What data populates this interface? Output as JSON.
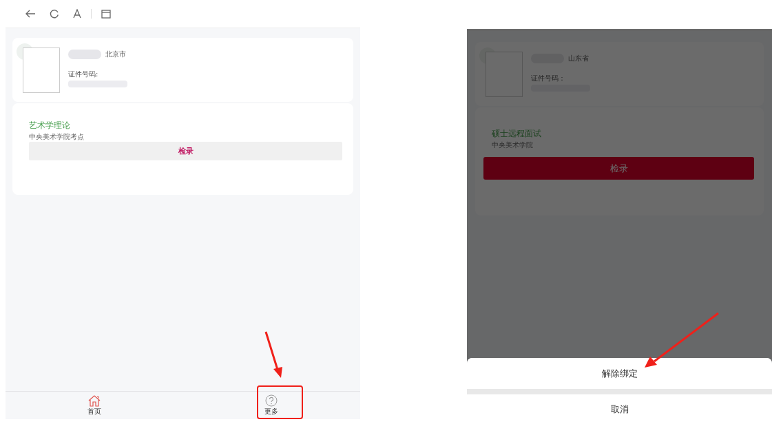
{
  "left_screen": {
    "profile": {
      "region": "北京市",
      "id_label": "证件号码:"
    },
    "exam": {
      "title": "艺术学理论",
      "school": "中央美术学院考点",
      "button": "检录",
      "disabled": true
    },
    "tab_bar": [
      {
        "label": "首页",
        "selected": true
      },
      {
        "label": "更多",
        "selected": false
      }
    ]
  },
  "right_screen": {
    "dimmed": true,
    "profile": {
      "region": "山东省",
      "id_label": "证件号码："
    },
    "exam": {
      "title": "硕士远程面试",
      "school": "中央美术学院",
      "button": "检录",
      "disabled": false
    },
    "action_sheet": {
      "actions": [
        "解除绑定"
      ],
      "cancel": "取消"
    }
  }
}
